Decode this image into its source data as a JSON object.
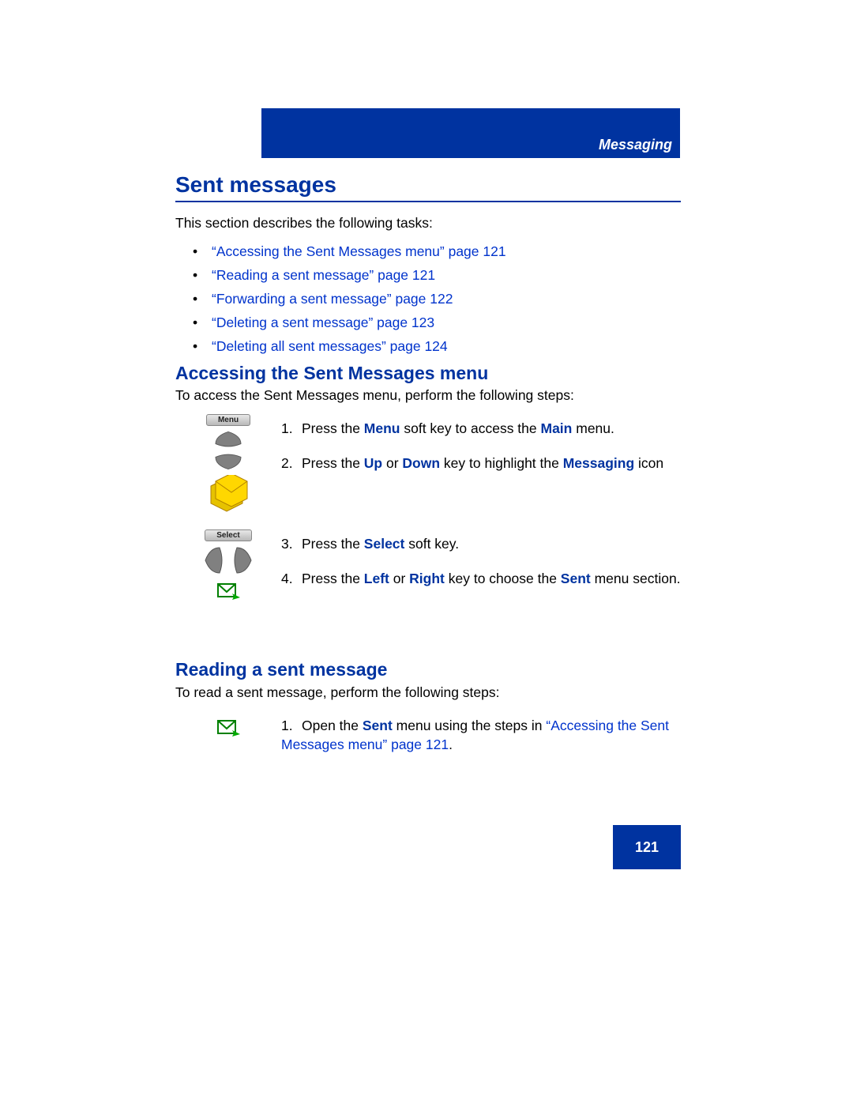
{
  "header": {
    "section_label": "Messaging"
  },
  "title": "Sent messages",
  "intro": "This section describes the following tasks:",
  "toc": [
    "“Accessing the Sent Messages menu” page 121",
    "“Reading a sent message” page 121",
    "“Forwarding a sent message” page 122",
    "“Deleting a sent message” page 123",
    "“Deleting all sent messages” page 124"
  ],
  "section_a": {
    "heading": "Accessing the Sent Messages menu",
    "intro": "To access the Sent Messages menu, perform the following steps:",
    "softkey_menu": "Menu",
    "softkey_select": "Select",
    "steps": {
      "s1": {
        "num": "1.",
        "t1": "Press the ",
        "k1": "Menu",
        "t2": " soft key to access the ",
        "k2": "Main",
        "t3": " menu."
      },
      "s2": {
        "num": "2.",
        "t1": "Press the ",
        "k1": "Up",
        "t2": " or ",
        "k2": "Down",
        "t3": " key to highlight the ",
        "k3": "Messaging",
        "t4": " icon"
      },
      "s3": {
        "num": "3.",
        "t1": "Press the ",
        "k1": "Select",
        "t2": " soft key."
      },
      "s4": {
        "num": "4.",
        "t1": "Press the ",
        "k1": "Left",
        "t2": " or ",
        "k2": "Right",
        "t3": " key to choose the ",
        "k3": "Sent",
        "t4": " menu section."
      }
    }
  },
  "section_b": {
    "heading": "Reading a sent message",
    "intro": "To read a sent message, perform the following steps:",
    "step1": {
      "num": "1.",
      "t1": "Open the ",
      "k1": "Sent",
      "t2": " menu using the steps in ",
      "link": "“Accessing the Sent Messages menu” page 121",
      "t3": "."
    }
  },
  "page_number": "121"
}
